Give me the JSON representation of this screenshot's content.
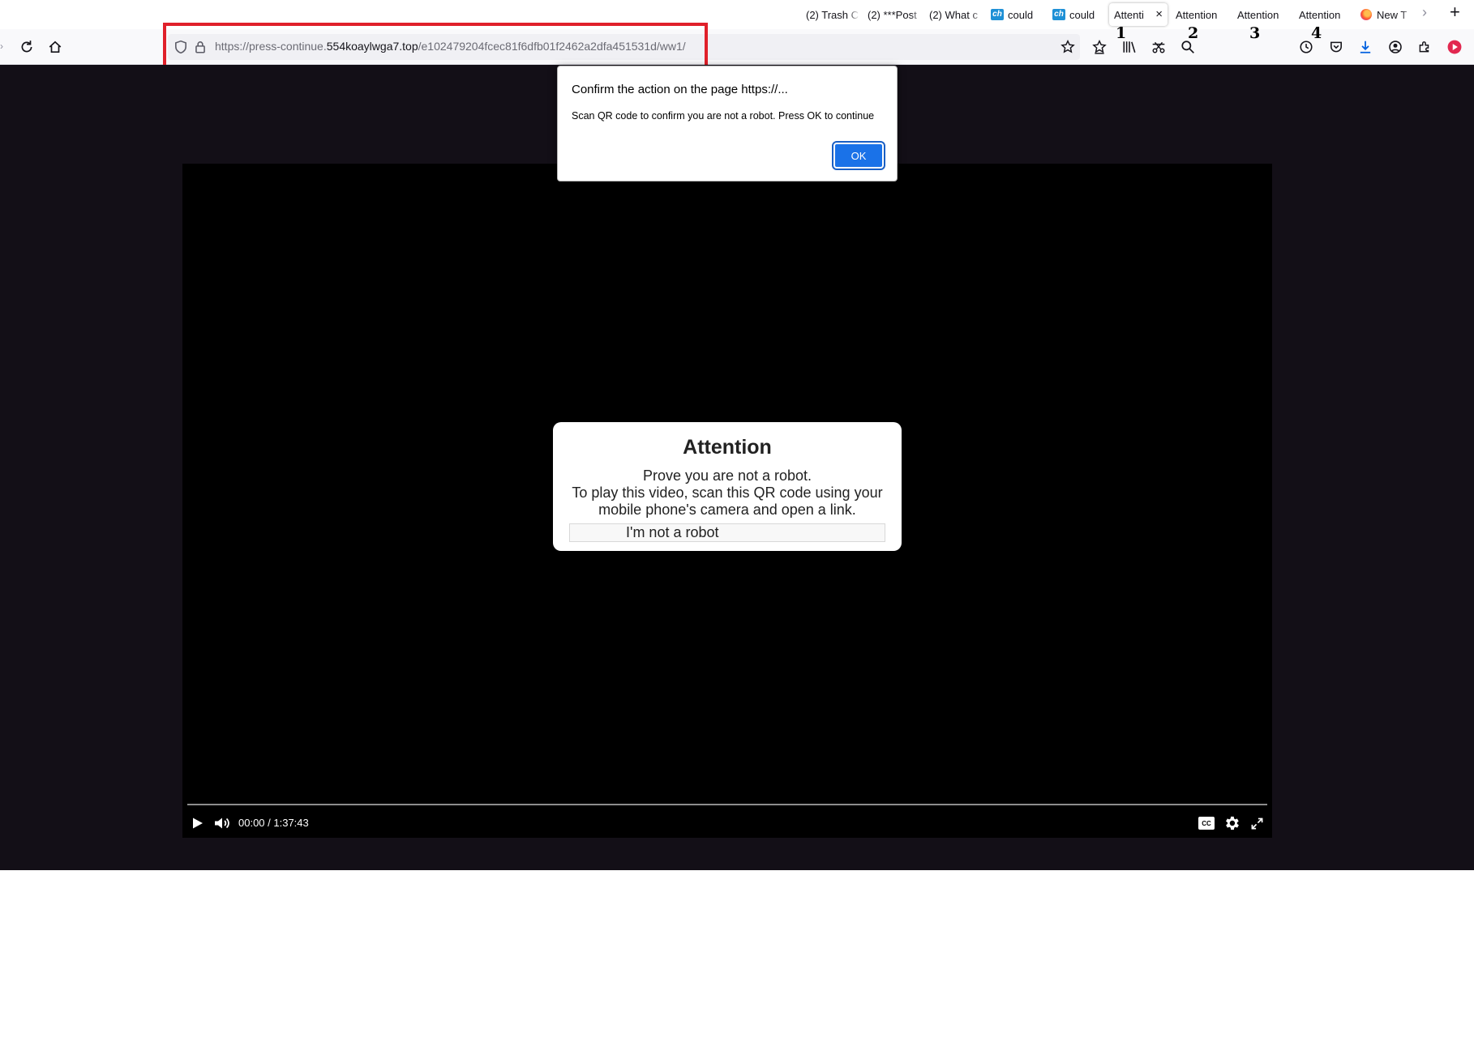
{
  "tabs": [
    {
      "label": "(2) Trash C",
      "favicon": "none"
    },
    {
      "label": "(2) ***Post",
      "favicon": "none"
    },
    {
      "label": "(2) What c",
      "favicon": "none"
    },
    {
      "label": "could",
      "favicon": "ch-icon"
    },
    {
      "label": "could",
      "favicon": "ch-icon"
    },
    {
      "label": "Attenti",
      "favicon": "none",
      "active": true
    },
    {
      "label": "Attention",
      "favicon": "none"
    },
    {
      "label": "Attention",
      "favicon": "none"
    },
    {
      "label": "Attention",
      "favicon": "none"
    },
    {
      "label": "New T",
      "favicon": "firefox-icon"
    }
  ],
  "tab_controls": {
    "scroll_right": "›",
    "new_tab": "+",
    "close": "×"
  },
  "url": {
    "prefix": "https://press-continue.",
    "domain": "554koaylwga7.top",
    "path": "/e102479204fcec81f6dfb01f2462a2dfa451531d/ww1/"
  },
  "annotations": [
    "1",
    "2",
    "3",
    "4"
  ],
  "dialog": {
    "title": "Confirm the action on the page https://...",
    "message": "Scan QR code to confirm you are not a robot. Press OK to continue",
    "ok_label": "OK"
  },
  "attention": {
    "title": "Attention",
    "line1": "Prove you are not a robot.",
    "line2": "To play this video, scan this QR code using your mobile phone's camera and open a link.",
    "button": "I'm not a robot"
  },
  "player": {
    "time": "00:00 / 1:37:43",
    "cc_label": "CC"
  },
  "colors": {
    "annotation_box": "#e0202a",
    "ok_button": "#1a72e8",
    "page_bg": "#130f17",
    "accent_red": "#e22850"
  }
}
